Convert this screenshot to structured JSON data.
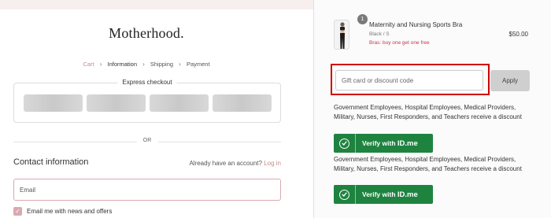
{
  "brand": {
    "logo_text": "Motherhood."
  },
  "breadcrumbs": [
    {
      "label": "Cart"
    },
    {
      "label": "Information"
    },
    {
      "label": "Shipping"
    },
    {
      "label": "Payment"
    }
  ],
  "express_checkout": {
    "title": "Express checkout"
  },
  "divider": {
    "text": "OR"
  },
  "contact": {
    "heading": "Contact information",
    "account_prompt": "Already have an account?",
    "login_link": "Log in",
    "email_placeholder": "Email",
    "email_value": "",
    "newsletter_label": "Email me with news and offers",
    "newsletter_checked": true
  },
  "order": {
    "quantity_badge": "1",
    "product_name": "Maternity and Nursing Sports Bra",
    "variant": "Black / S",
    "promo": "Bras: buy one get one free",
    "price": "$50.00"
  },
  "discount": {
    "placeholder": "Gift card or discount code",
    "value": "",
    "apply_label": "Apply"
  },
  "idme_offers": [
    {
      "description": "Government Employees, Hospital Employees, Medical Providers, Military, Nurses, First Responders, and Teachers receive a discount",
      "button_prefix": "Verify with",
      "button_brand": "ID.me"
    },
    {
      "description": "Government Employees, Hospital Employees, Medical Providers, Military, Nurses, First Responders, and Teachers receive a discount",
      "button_prefix": "Verify with",
      "button_brand": "ID.me"
    }
  ],
  "colors": {
    "accent_pink": "#c58b8b",
    "checkbox_pink": "#d9a9b0",
    "promo_red": "#c0394b",
    "highlight_red": "#d10000",
    "idme_green": "#1f8340"
  }
}
